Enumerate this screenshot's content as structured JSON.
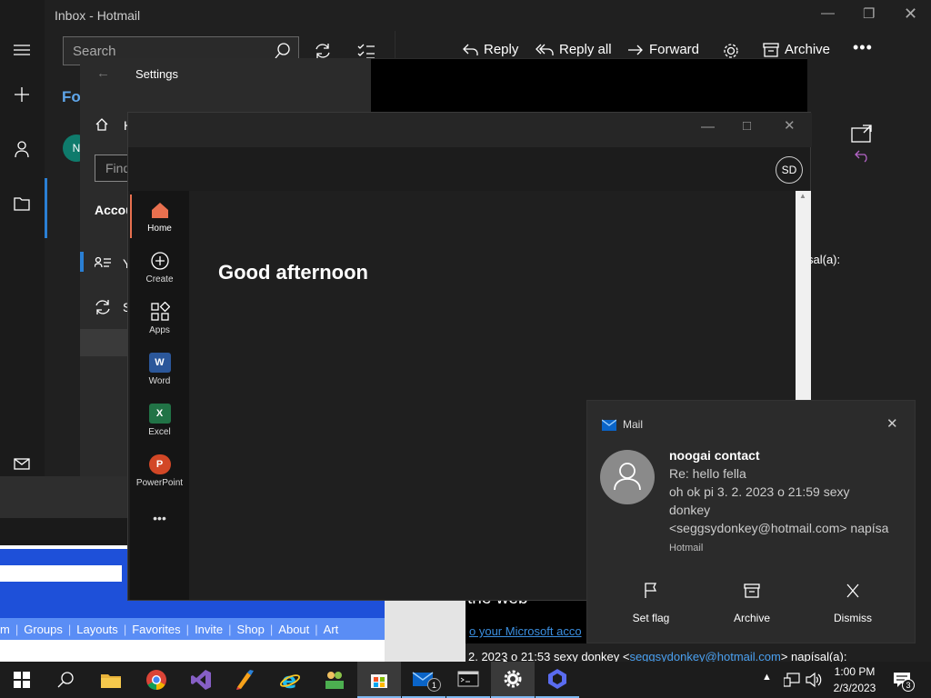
{
  "mail_app": {
    "title": "Inbox - Hotmail",
    "search_placeholder": "Search",
    "folder_tab_partial": "Fo",
    "avatar_partial": "N",
    "find_partial": "Find",
    "account_partial": "Accou",
    "item_y_partial": "Y",
    "item_s_partial": "S",
    "home_partial": "H",
    "toolbar": {
      "reply": "Reply",
      "reply_all": "Reply all",
      "forward": "Forward",
      "archive": "Archive"
    },
    "body_partial_napisal": "sal(a):",
    "web_partial": "the web",
    "ms_account_partial": "o your Microsoft acco",
    "quote_line_prefix": "2. 2023 o 21:53 sexy donkey <",
    "quote_line_email": "seggsydonkey@hotmail.com",
    "quote_line_suffix": "> napísal(a):"
  },
  "settings_window": {
    "title": "Settings"
  },
  "office_window": {
    "user_initials": "SD",
    "greeting": "Good afternoon",
    "rail": [
      {
        "label": "Home",
        "icon": "home-icon"
      },
      {
        "label": "Create",
        "icon": "plus-circle-icon"
      },
      {
        "label": "Apps",
        "icon": "apps-icon"
      },
      {
        "label": "Word",
        "icon": "word-icon",
        "letter": "W",
        "color": "#2b579a"
      },
      {
        "label": "Excel",
        "icon": "excel-icon",
        "letter": "X",
        "color": "#217346"
      },
      {
        "label": "PowerPoint",
        "icon": "powerpoint-icon",
        "letter": "P",
        "color": "#d24726"
      }
    ],
    "accent": "#e8704f"
  },
  "toast": {
    "app_name": "Mail",
    "sender": "noogai contact",
    "subject": "Re: hello fella",
    "preview_line1": "oh ok pi 3. 2. 2023 o 21:59 sexy",
    "preview_line2": "donkey",
    "preview_line3": "<seggsydonkey@hotmail.com> napísa",
    "account": "Hotmail",
    "actions": {
      "flag": "Set flag",
      "archive": "Archive",
      "dismiss": "Dismiss"
    }
  },
  "browser_fragment": {
    "nav": [
      "m",
      "Groups",
      "Layouts",
      "Favorites",
      "Invite",
      "Shop",
      "About",
      "Art"
    ]
  },
  "taskbar": {
    "time": "1:00 PM",
    "date": "2/3/2023",
    "mail_badge": "1",
    "notif_count": "3"
  }
}
